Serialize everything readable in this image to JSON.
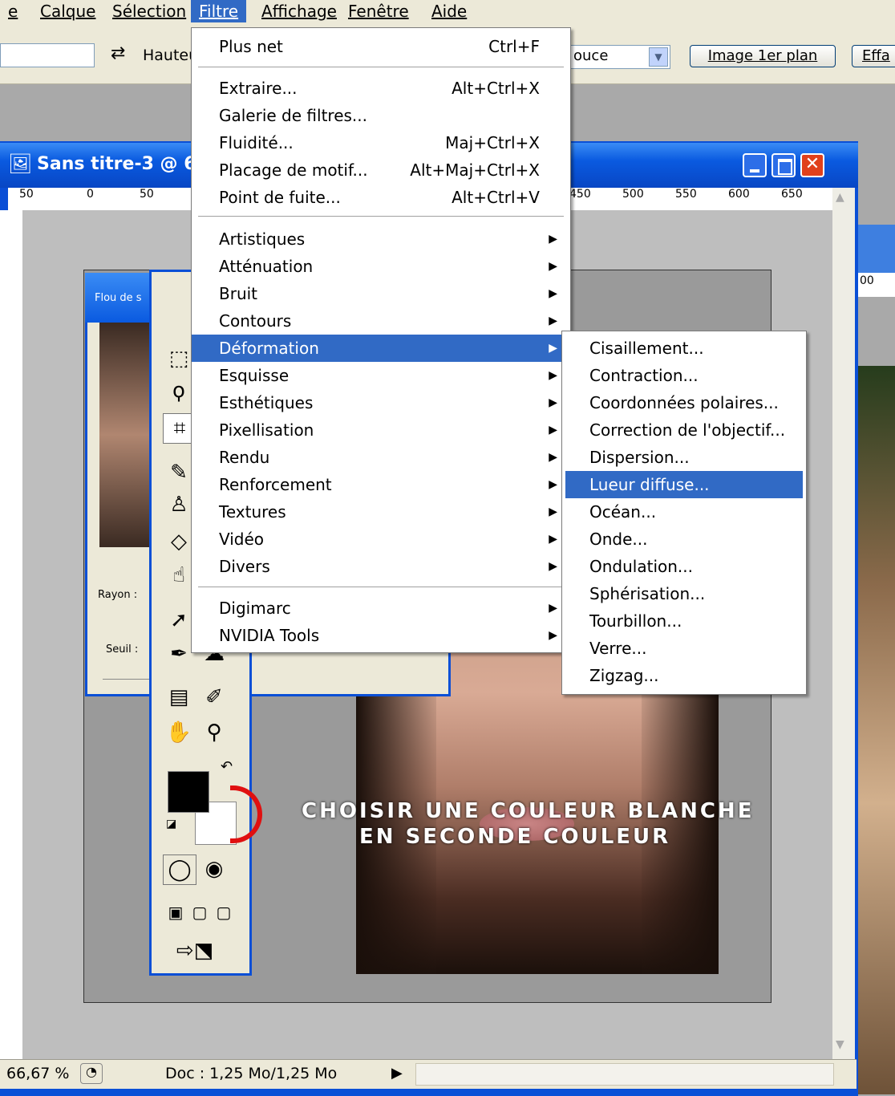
{
  "menubar": {
    "items": [
      "e",
      "Calque",
      "Sélection",
      "Filtre",
      "Affichage",
      "Fenêtre",
      "Aide"
    ]
  },
  "options": {
    "hauteur_label": "Hauteu",
    "select_value": "ouce",
    "image_btn": "Image 1er plan",
    "effacer_btn": "Effa"
  },
  "document": {
    "title": "Sans titre-3 @ 6",
    "ruler_top": [
      "50",
      "0",
      "50",
      "450",
      "500",
      "550",
      "600",
      "650"
    ],
    "right_ruler": "00",
    "overlay_line1": "CHOISIR UNE COULEUR BLANCHE",
    "overlay_line2": "EN SECONDE COULEUR"
  },
  "dialog": {
    "title": "Flou de s",
    "label1": "Rayon :",
    "label2": "Seuil :"
  },
  "status": {
    "zoom": "66,67 %",
    "doc": "Doc : 1,25 Mo/1,25 Mo"
  },
  "filtermenu": {
    "top_items": [
      {
        "label": "Plus net",
        "shortcut": "Ctrl+F"
      },
      {
        "label": "Extraire...",
        "shortcut": "Alt+Ctrl+X"
      },
      {
        "label": "Galerie de filtres...",
        "shortcut": ""
      },
      {
        "label": "Fluidité...",
        "shortcut": "Maj+Ctrl+X"
      },
      {
        "label": "Placage de motif...",
        "shortcut": "Alt+Maj+Ctrl+X"
      },
      {
        "label": "Point de fuite...",
        "shortcut": "Alt+Ctrl+V"
      }
    ],
    "sub_items": [
      "Artistiques",
      "Atténuation",
      "Bruit",
      "Contours",
      "Déformation",
      "Esquisse",
      "Esthétiques",
      "Pixellisation",
      "Rendu",
      "Renforcement",
      "Textures",
      "Vidéo",
      "Divers"
    ],
    "plugin_items": [
      "Digimarc",
      "NVIDIA Tools"
    ],
    "highlighted": "Déformation"
  },
  "submenu": {
    "items": [
      "Cisaillement...",
      "Contraction...",
      "Coordonnées polaires...",
      "Correction de l'objectif...",
      "Dispersion...",
      "Lueur diffuse...",
      "Océan...",
      "Onde...",
      "Ondulation...",
      "Sphérisation...",
      "Tourbillon...",
      "Verre...",
      "Zigzag..."
    ],
    "highlighted": "Lueur diffuse..."
  },
  "colors": {
    "menu_highlight": "#316ac5",
    "titlebar": "#0a5ae0",
    "annotation": "#e01010"
  }
}
